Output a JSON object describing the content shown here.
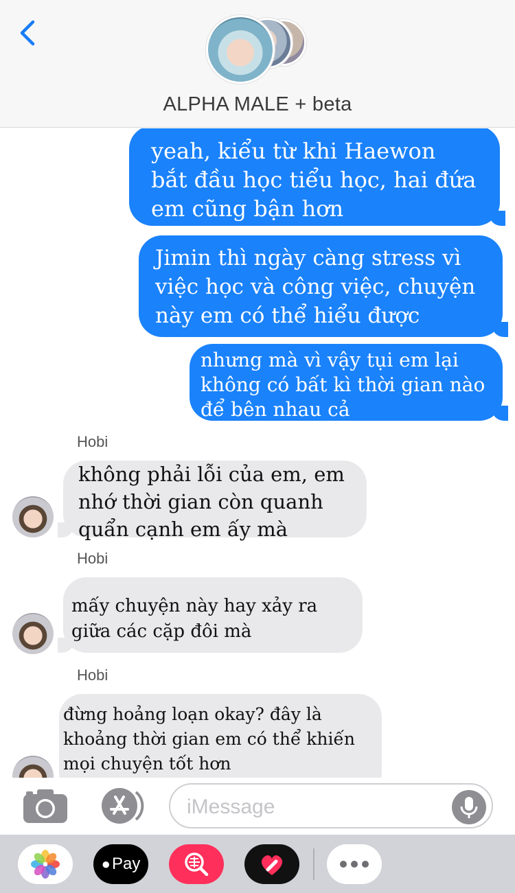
{
  "header": {
    "title": "ALPHA MALE + beta",
    "back_icon": "chevron-left-icon"
  },
  "messages": [
    {
      "direction": "outgoing",
      "lines": [
        "yeah, kiểu từ khi Haewon",
        "bắt đầu học tiểu học, hai đứa",
        "em cũng bận hơn"
      ]
    },
    {
      "direction": "outgoing",
      "lines": [
        "Jimin thì ngày càng stress vì",
        "việc học và công việc, chuyện",
        "này em có thể hiểu được"
      ]
    },
    {
      "direction": "outgoing",
      "lines": [
        "nhưng mà vì vậy tụi em lại",
        "không có bất kì thời gian nào",
        "để bên nhau cả"
      ]
    },
    {
      "direction": "incoming",
      "sender": "Hobi",
      "lines": [
        "không phải lỗi của em, em",
        "nhớ thời gian còn quanh",
        "quẩn cạnh em ấy mà"
      ]
    },
    {
      "direction": "incoming",
      "sender": "Hobi",
      "lines": [
        "mấy chuyện này hay xảy ra",
        "giữa các cặp đôi mà"
      ]
    },
    {
      "direction": "incoming",
      "sender": "Hobi",
      "lines": [
        "đừng hoảng loạn okay? đây là",
        "khoảng thời gian em có thể khiến",
        "mọi chuyện tốt hơn"
      ]
    }
  ],
  "input": {
    "placeholder": "iMessage",
    "camera_icon": "camera-icon",
    "appstore_icon": "app-store-icon",
    "mic_icon": "microphone-icon"
  },
  "drawer": {
    "apple_pay_label": "Pay",
    "apps": [
      "photos-icon",
      "apple-pay-icon",
      "web-search-icon",
      "digital-touch-icon",
      "more-icon"
    ]
  },
  "colors": {
    "outgoing_bubble": "#1a82fb",
    "incoming_bubble": "#e9e9eb",
    "accent": "#1a7cf6"
  }
}
